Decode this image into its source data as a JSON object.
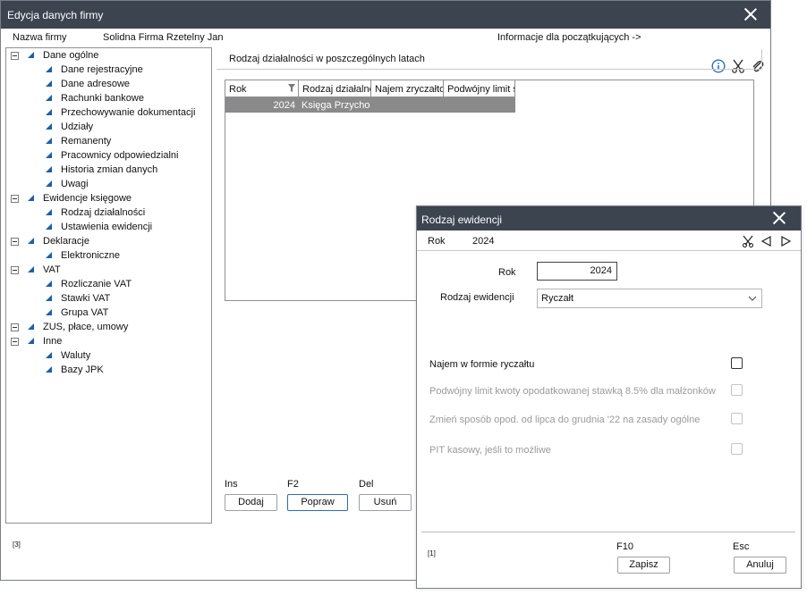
{
  "main": {
    "title": "Edycja danych firmy",
    "info": {
      "company_label": "Nazwa firmy",
      "company_value": "Solidna Firma Rzetelny Jan",
      "beginner_link": "Informacje dla początkujących ->"
    },
    "tree": [
      {
        "label": "Dane ogólne",
        "level": 0,
        "toggle": true
      },
      {
        "label": "Dane rejestracyjne",
        "level": 1
      },
      {
        "label": "Dane adresowe",
        "level": 1
      },
      {
        "label": "Rachunki bankowe",
        "level": 1
      },
      {
        "label": "Przechowywanie dokumentacji",
        "level": 1
      },
      {
        "label": "Udziały",
        "level": 1
      },
      {
        "label": "Remanenty",
        "level": 1
      },
      {
        "label": "Pracownicy odpowiedzialni",
        "level": 1
      },
      {
        "label": "Historia zmian danych",
        "level": 1
      },
      {
        "label": "Uwagi",
        "level": 1
      },
      {
        "label": "Ewidencje księgowe",
        "level": 0,
        "toggle": true
      },
      {
        "label": "Rodzaj działalności",
        "level": 1
      },
      {
        "label": "Ustawienia ewidencji",
        "level": 1
      },
      {
        "label": "Deklaracje",
        "level": 0,
        "toggle": true
      },
      {
        "label": "Elektroniczne",
        "level": 1
      },
      {
        "label": "VAT",
        "level": 0,
        "toggle": true
      },
      {
        "label": "Rozliczanie VAT",
        "level": 1
      },
      {
        "label": "Stawki VAT",
        "level": 1
      },
      {
        "label": "Grupa VAT",
        "level": 1
      },
      {
        "label": "ZUS, płace, umowy",
        "level": 0,
        "toggle": true
      },
      {
        "label": "Inne",
        "level": 0,
        "toggle": true
      },
      {
        "label": "Waluty",
        "level": 1
      },
      {
        "label": "Bazy JPK",
        "level": 1
      }
    ],
    "section_title": "Rodzaj działalności w poszczególnych latach",
    "grid": {
      "columns": [
        "Rok",
        "Rodzaj działalności",
        "Najem zryczałtowany",
        "Podwójny limit skali"
      ],
      "rows": [
        {
          "rok": "2024",
          "rodzaj": "Księga Przychodów"
        }
      ]
    },
    "buttons": {
      "add_hotkey": "Ins",
      "add": "Dodaj",
      "edit_hotkey": "F2",
      "edit": "Popraw",
      "delete_hotkey": "Del",
      "delete": "Usuń"
    },
    "footer_counter": "[3]"
  },
  "dialog": {
    "title": "Rodzaj ewidencji",
    "info_label": "Rok",
    "info_value": "2024",
    "year_label": "Rok",
    "year_value": "2024",
    "type_label": "Rodzaj ewidencji",
    "type_value": "Ryczałt",
    "options": [
      {
        "label": "Najem w formie ryczałtu",
        "enabled": true,
        "checked": false
      },
      {
        "label": "Podwójny limit kwoty opodatkowanej stawką 8.5% dla małżonków",
        "enabled": false,
        "checked": false
      },
      {
        "label": "Zmień sposób opod. od lipca do grudnia '22 na zasady ogólne",
        "enabled": false,
        "checked": false
      },
      {
        "label": "PIT kasowy, jeśli to możliwe",
        "enabled": false,
        "checked": false
      }
    ],
    "footer_counter": "[1]",
    "save_hotkey": "F10",
    "save": "Zapisz",
    "cancel_hotkey": "Esc",
    "cancel": "Anuluj"
  },
  "colors": {
    "titlebar": "#3c4450",
    "accent": "#2b6cc4",
    "tree_icon": "#1b5fa8",
    "selected_row": "#8a8a8a"
  }
}
